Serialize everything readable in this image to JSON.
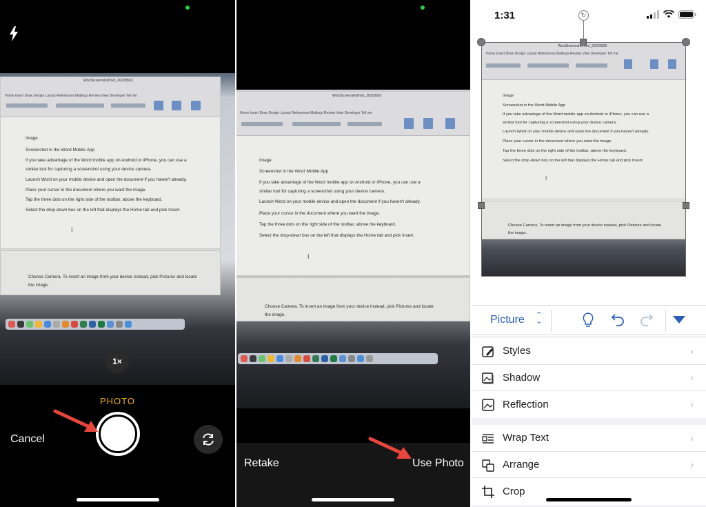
{
  "panel_camera": {
    "mode_label": "PHOTO",
    "cancel_label": "Cancel",
    "zoom_label": "1×"
  },
  "panel_review": {
    "retake_label": "Retake",
    "use_photo_label": "Use Photo"
  },
  "panel_editor": {
    "status_time": "1:31",
    "toolbar": {
      "picture_label": "Picture"
    },
    "menu": {
      "styles": "Styles",
      "shadow": "Shadow",
      "reflection": "Reflection",
      "wrap_text": "Wrap Text",
      "arrange": "Arrange",
      "crop": "Crop"
    }
  },
  "photographed_document": {
    "title_bar": "WordScreenshotTool_20220830",
    "ribbon_tabs": "Home   Insert   Draw   Design   Layout   References   Mailings   Review   View   Developer   Tell me",
    "heading": "Image",
    "subheading": "Screenshot in the Word Mobile App",
    "line1": "If you take advantage of the Word mobile app on Android or iPhone, you can use a",
    "line2": "similar tool for capturing a screenshot using your device camera.",
    "line3": "Launch Word on your mobile device and open the document if you haven't already.",
    "line4": "Place your cursor in the document where you want the image.",
    "line5": "Tap the three dots on the right side of the toolbar, above the keyboard.",
    "line6": "Select the drop-down box on the left that displays the Home tab and pick Insert.",
    "line7": "Choose Camera. To insert an image from your device instead, pick Pictures and locate",
    "line8": "the image."
  },
  "colors": {
    "accent_blue": "#2b5fb4",
    "photo_mode_yellow": "#f4b400",
    "arrow_red": "#e8453c"
  }
}
